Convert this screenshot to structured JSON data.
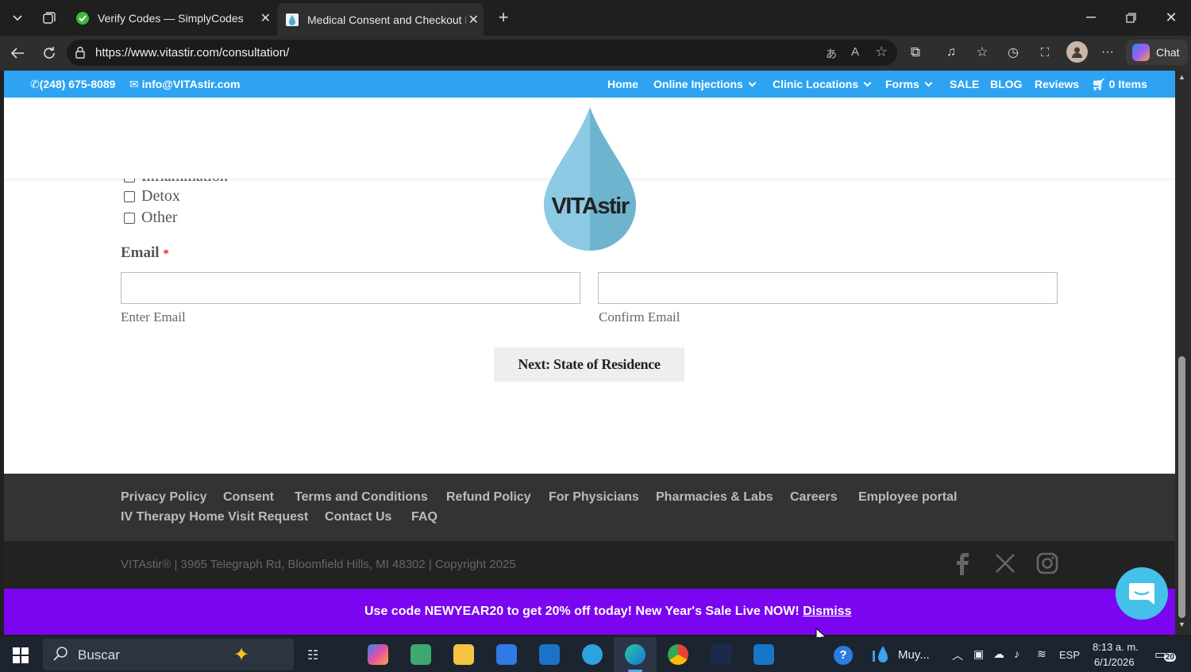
{
  "browser": {
    "tabs": [
      {
        "title": "Verify Codes — SimplyCodes",
        "active": false
      },
      {
        "title": "Medical Consent and Checkout Fo",
        "active": true
      }
    ],
    "url": "https://www.vitastir.com/consultation/",
    "chat_label": "Chat"
  },
  "header": {
    "phone": "(248) 675-8089",
    "email": "info@VITAstir.com",
    "nav": [
      "Home",
      "Online Injections",
      "Clinic Locations",
      "Forms",
      "SALE",
      "BLOG",
      "Reviews",
      "0 Items"
    ]
  },
  "logo": {
    "text": "VITAstir",
    "colors": {
      "drop_light": "#8cc9e2",
      "drop_dark": "#6eb4cf"
    }
  },
  "form": {
    "checkbox_partial": "Inflammation",
    "checkboxes": [
      "Detox",
      "Other"
    ],
    "email_label": "Email",
    "required_mark": "*",
    "enter_email_label": "Enter Email",
    "confirm_email_label": "Confirm Email",
    "next_button": "Next: State of Residence"
  },
  "footer": {
    "links_row1": [
      "Privacy Policy",
      "Consent",
      "Terms and Conditions",
      "Refund Policy",
      "For Physicians",
      "Pharmacies & Labs",
      "Careers",
      "Employee portal"
    ],
    "links_row2": [
      "IV Therapy Home Visit Request",
      "Contact Us",
      "FAQ"
    ],
    "copyright": "VITAstir® | 3965 Telegraph Rd, Bloomfield Hills, MI 48302 | Copyright 2025",
    "social": [
      "facebook-icon",
      "x-icon",
      "instagram-icon"
    ]
  },
  "promo": {
    "text": "Use code NEWYEAR20 to get 20% off today! New Year's Sale Live NOW!",
    "dismiss": "Dismiss",
    "color": "#7b05f0"
  },
  "taskbar": {
    "search_placeholder": "Buscar",
    "weather": "Muy...",
    "language": "ESP",
    "time": "8:13 a. m.",
    "date": "6/1/2026",
    "notifications": "20"
  }
}
